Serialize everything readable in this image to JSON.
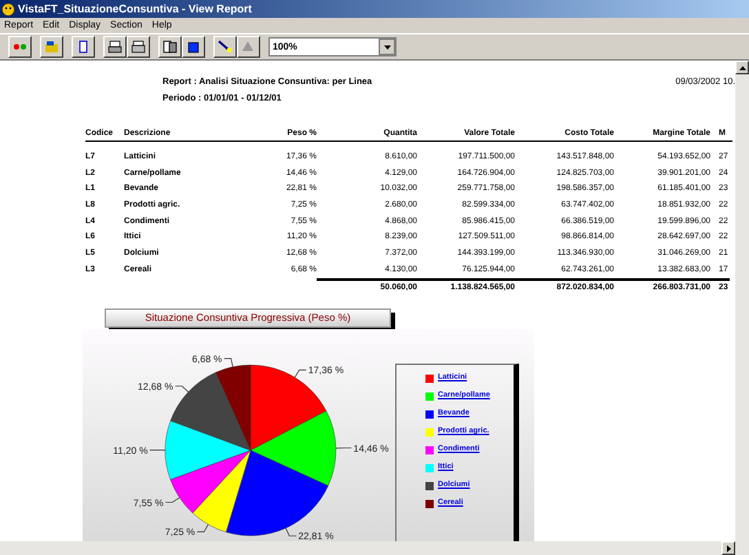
{
  "window": {
    "title": "VistaFT_SituazioneConsuntiva - View Report"
  },
  "menu": [
    "Report",
    "Edit",
    "Display",
    "Section",
    "Help"
  ],
  "toolbar": {
    "zoom": "100%"
  },
  "report": {
    "title": "Report : Analisi Situazione Consuntiva: per Linea",
    "period": "Periodo : 01/01/01 - 01/12/01",
    "date": "09/03/2002 10."
  },
  "table": {
    "columns": [
      "Codice",
      "Descrizione",
      "Peso %",
      "Quantita",
      "Valore Totale",
      "Costo Totale",
      "Margine Totale",
      "M"
    ],
    "rows": [
      [
        "L7",
        "Latticini",
        "17,36 %",
        "8.610,00",
        "197.711.500,00",
        "143.517.848,00",
        "54.193.652,00",
        "27"
      ],
      [
        "L2",
        "Carne/pollame",
        "14,46 %",
        "4.129,00",
        "164.726.904,00",
        "124.825.703,00",
        "39.901.201,00",
        "24"
      ],
      [
        "L1",
        "Bevande",
        "22,81 %",
        "10.032,00",
        "259.771.758,00",
        "198.586.357,00",
        "61.185.401,00",
        "23"
      ],
      [
        "L8",
        "Prodotti agric.",
        "7,25 %",
        "2.680,00",
        "82.599.334,00",
        "63.747.402,00",
        "18.851.932,00",
        "22"
      ],
      [
        "L4",
        "Condimenti",
        "7,55 %",
        "4.868,00",
        "85.986.415,00",
        "66.386.519,00",
        "19.599.896,00",
        "22"
      ],
      [
        "L6",
        "Ittici",
        "11,20 %",
        "8.239,00",
        "127.509.511,00",
        "98.866.814,00",
        "28.642.697,00",
        "22"
      ],
      [
        "L5",
        "Dolciumi",
        "12,68 %",
        "7.372,00",
        "144.393.199,00",
        "113.346.930,00",
        "31.046.269,00",
        "21"
      ],
      [
        "L3",
        "Cereali",
        "6,68 %",
        "4.130,00",
        "76.125.944,00",
        "62.743.261,00",
        "13.382.683,00",
        "17"
      ]
    ],
    "totals": [
      "50.060,00",
      "1.138.824.565,00",
      "872.020.834,00",
      "266.803.731,00",
      "23"
    ]
  },
  "chart": {
    "title": "Situazione Consuntiva Progressiva (Peso %)",
    "chart_data": {
      "type": "pie",
      "categories": [
        "Latticini",
        "Carne/pollame",
        "Bevande",
        "Prodotti agric.",
        "Condimenti",
        "Ittici",
        "Dolciumi",
        "Cereali"
      ],
      "values": [
        17.36,
        14.46,
        22.81,
        7.25,
        7.55,
        11.2,
        12.68,
        6.68
      ],
      "data_labels": true,
      "value_labels": [
        "17,36 %",
        "14,46 %",
        "22,81 %",
        "7,25 %",
        "7,55 %",
        "11,20 %",
        "12,68 %",
        "6,68 %"
      ]
    },
    "legend": [
      {
        "color": "#ff0000"
      },
      {
        "color": "#00ff00"
      },
      {
        "color": "#0000ff"
      },
      {
        "color": "#ffff00"
      },
      {
        "color": "#ff00ff"
      },
      {
        "color": "#00ffff"
      },
      {
        "color": "#444444"
      },
      {
        "color": "#800000"
      }
    ]
  }
}
